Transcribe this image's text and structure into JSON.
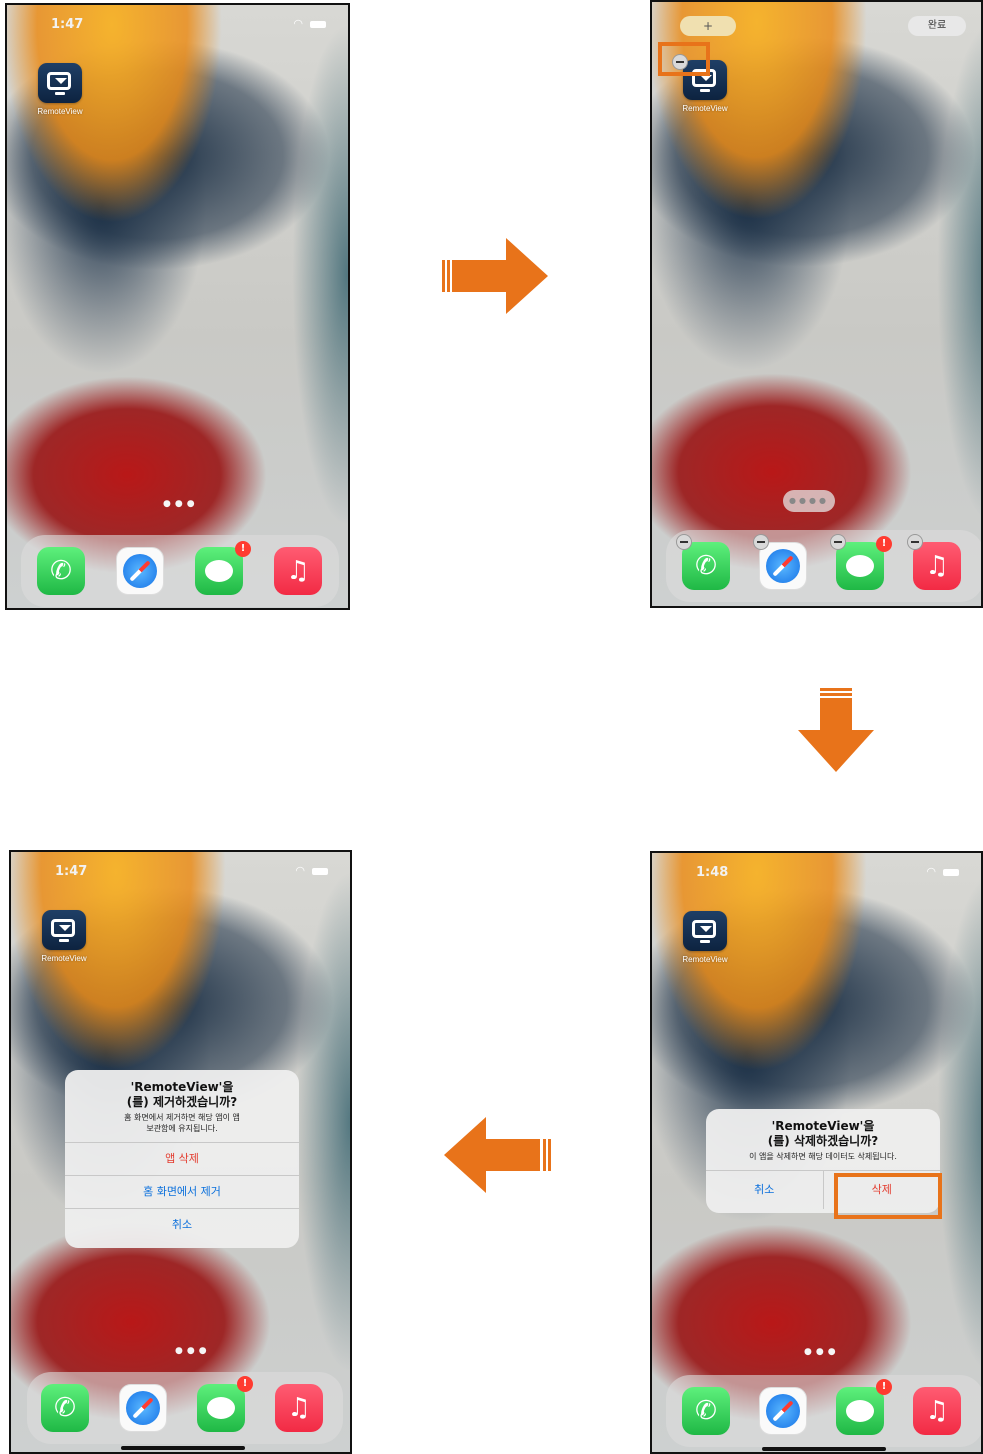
{
  "screens": {
    "s1": {
      "time": "1:47",
      "app_label": "RemoteView"
    },
    "s2": {
      "app_label": "RemoteView",
      "add_button": "+",
      "done_button": "완료"
    },
    "s3": {
      "time": "1:48",
      "app_label": "RemoteView",
      "alert": {
        "title_line1": "'RemoteView'을",
        "title_line2": "(를) 삭제하겠습니까?",
        "message": "이 앱을 삭제하면 해당 데이터도 삭제됩니다.",
        "cancel": "취소",
        "delete": "삭제"
      }
    },
    "s4": {
      "time": "1:47",
      "app_label": "RemoteView",
      "alert": {
        "title_line1": "'RemoteView'을",
        "title_line2": "(를) 제거하겠습니까?",
        "message_line1": "홈 화면에서 제거하면 해당 앱이 앱",
        "message_line2": "보관함에 유지됩니다.",
        "delete_app": "앱 삭제",
        "remove_home": "홈 화면에서 제거",
        "cancel": "취소"
      }
    }
  },
  "dock_icons": [
    "phone-icon",
    "safari-icon",
    "messages-icon",
    "music-icon"
  ],
  "messages_badge": "!",
  "colors": {
    "arrow": "#e8731a",
    "highlight": "#e8731a",
    "destructive": "#e33b2e",
    "ios_blue": "#0a6fdc"
  }
}
